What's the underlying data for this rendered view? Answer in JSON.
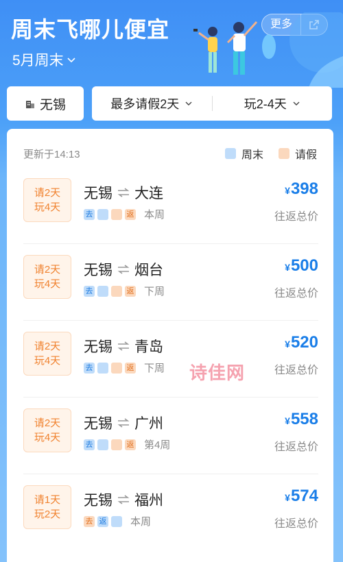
{
  "header": {
    "title": "周末飞哪儿便宜",
    "subtitle": "5月周末",
    "more_label": "更多"
  },
  "filters": {
    "city": "无锡",
    "leave": "最多请假2天",
    "duration": "玩2-4天"
  },
  "card": {
    "updated": "更新于14:13",
    "legend_weekend": "周末",
    "legend_leave": "请假",
    "deals": [
      {
        "badge_leave": "请2天",
        "badge_play": "玩4天",
        "origin": "无锡",
        "destination": "大连",
        "days": [
          {
            "type": "weekend",
            "label": "去"
          },
          {
            "type": "weekend",
            "label": ""
          },
          {
            "type": "leave",
            "label": ""
          },
          {
            "type": "leave",
            "label": "返"
          }
        ],
        "period": "本周",
        "currency": "¥",
        "price": "398",
        "price_label": "往返总价"
      },
      {
        "badge_leave": "请2天",
        "badge_play": "玩4天",
        "origin": "无锡",
        "destination": "烟台",
        "days": [
          {
            "type": "weekend",
            "label": "去"
          },
          {
            "type": "weekend",
            "label": ""
          },
          {
            "type": "leave",
            "label": ""
          },
          {
            "type": "leave",
            "label": "返"
          }
        ],
        "period": "下周",
        "currency": "¥",
        "price": "500",
        "price_label": "往返总价"
      },
      {
        "badge_leave": "请2天",
        "badge_play": "玩4天",
        "origin": "无锡",
        "destination": "青岛",
        "days": [
          {
            "type": "weekend",
            "label": "去"
          },
          {
            "type": "weekend",
            "label": ""
          },
          {
            "type": "leave",
            "label": ""
          },
          {
            "type": "leave",
            "label": "返"
          }
        ],
        "period": "下周",
        "currency": "¥",
        "price": "520",
        "price_label": "往返总价"
      },
      {
        "badge_leave": "请2天",
        "badge_play": "玩4天",
        "origin": "无锡",
        "destination": "广州",
        "days": [
          {
            "type": "weekend",
            "label": "去"
          },
          {
            "type": "weekend",
            "label": ""
          },
          {
            "type": "leave",
            "label": ""
          },
          {
            "type": "leave",
            "label": "返"
          }
        ],
        "period": "第4周",
        "currency": "¥",
        "price": "558",
        "price_label": "往返总价"
      },
      {
        "badge_leave": "请1天",
        "badge_play": "玩2天",
        "origin": "无锡",
        "destination": "福州",
        "days": [
          {
            "type": "leave",
            "label": "去"
          },
          {
            "type": "weekend",
            "label": "返"
          },
          {
            "type": "weekend",
            "label": ""
          }
        ],
        "period": "本周",
        "currency": "¥",
        "price": "574",
        "price_label": "往返总价"
      }
    ]
  },
  "watermark": "诗佳网",
  "colors": {
    "accent": "#1a7ee8",
    "leave": "#f0822f",
    "weekend_swatch": "#bfdcfa",
    "leave_swatch": "#fbd8bd"
  },
  "icons": [
    "chevron-down-icon",
    "share-icon",
    "building-icon",
    "round-trip-arrows-icon"
  ]
}
